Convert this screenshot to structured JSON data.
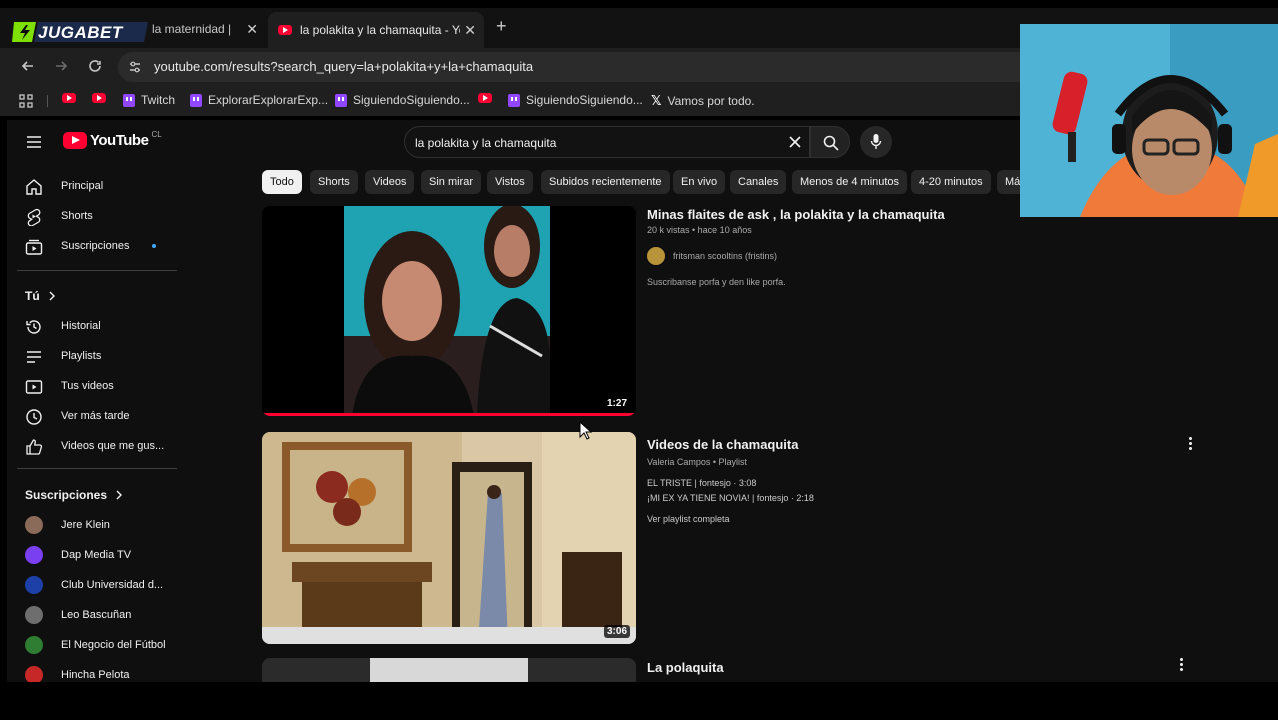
{
  "browser": {
    "tabs": [
      {
        "title": "la maternidad |",
        "active": false
      },
      {
        "title": "la polakita y la chamaquita - Yo",
        "active": true
      }
    ],
    "new_tab": "+",
    "close": "✕",
    "url": "youtube.com/results?search_query=la+polakita+y+la+chamaquita",
    "bookmarks": [
      {
        "label": "",
        "icon": "youtube-icon"
      },
      {
        "label": "",
        "icon": "youtube-icon"
      },
      {
        "label": "Twitch",
        "icon": "twitch-icon"
      },
      {
        "label": "ExplorarExplorarExp...",
        "icon": "twitch-icon"
      },
      {
        "label": "SiguiendoSiguiendo...",
        "icon": "twitch-icon"
      },
      {
        "label": "",
        "icon": "youtube-icon"
      },
      {
        "label": "SiguiendoSiguiendo...",
        "icon": "twitch-icon"
      },
      {
        "label": "Vamos por todo.",
        "icon": "x-icon"
      }
    ]
  },
  "overlay": {
    "sponsor_logo_text": "JUGABET"
  },
  "youtube": {
    "logo": "YouTube",
    "country": "CL",
    "search_query": "la polakita y la chamaquita",
    "sidebar": {
      "main": [
        {
          "label": "Principal",
          "icon": "home-icon"
        },
        {
          "label": "Shorts",
          "icon": "shorts-icon"
        },
        {
          "label": "Suscripciones",
          "icon": "subscriptions-icon"
        }
      ],
      "you_header": "Tú",
      "you": [
        {
          "label": "Historial",
          "icon": "history-icon"
        },
        {
          "label": "Playlists",
          "icon": "playlists-icon"
        },
        {
          "label": "Tus videos",
          "icon": "your-videos-icon"
        },
        {
          "label": "Ver más tarde",
          "icon": "watch-later-icon"
        },
        {
          "label": "Videos que me gus...",
          "icon": "liked-icon"
        }
      ],
      "subs_header": "Suscripciones",
      "subs": [
        {
          "label": "Jere Klein",
          "color": "#8a6a58"
        },
        {
          "label": "Dap Media TV",
          "color": "#7b3ff2"
        },
        {
          "label": "Club Universidad d...",
          "color": "#1d3fa8"
        },
        {
          "label": "Leo Bascuñan",
          "color": "#6e6e6e"
        },
        {
          "label": "El Negocio del Fútbol",
          "color": "#2e7d32"
        },
        {
          "label": "Hincha Pelota",
          "color": "#c62828"
        }
      ]
    },
    "chips": [
      "Todo",
      "Shorts",
      "Videos",
      "Sin mirar",
      "Vistos",
      "Subidos recientemente",
      "En vivo",
      "Canales",
      "Menos de 4 minutos",
      "4-20 minutos",
      "Má"
    ],
    "results": [
      {
        "title": "Minas flaites de ask , la polakita y la chamaquita",
        "meta": "20 k vistas • hace 10 años",
        "channel": "fritsman scooltins (fristins)",
        "description": "Suscribanse porfa y den like porfa.",
        "duration": "1:27",
        "watched_fraction": 1.0
      },
      {
        "title": "Videos de la chamaquita",
        "meta": "Valeria Campos • Playlist",
        "items": [
          "EL TRISTE | fontesjo · 3:08",
          "¡MI EX YA TIENE NOVIA! | fontesjo · 2:18"
        ],
        "link": "Ver playlist completa",
        "duration": "3:06"
      },
      {
        "title": "La polaquita"
      }
    ]
  }
}
